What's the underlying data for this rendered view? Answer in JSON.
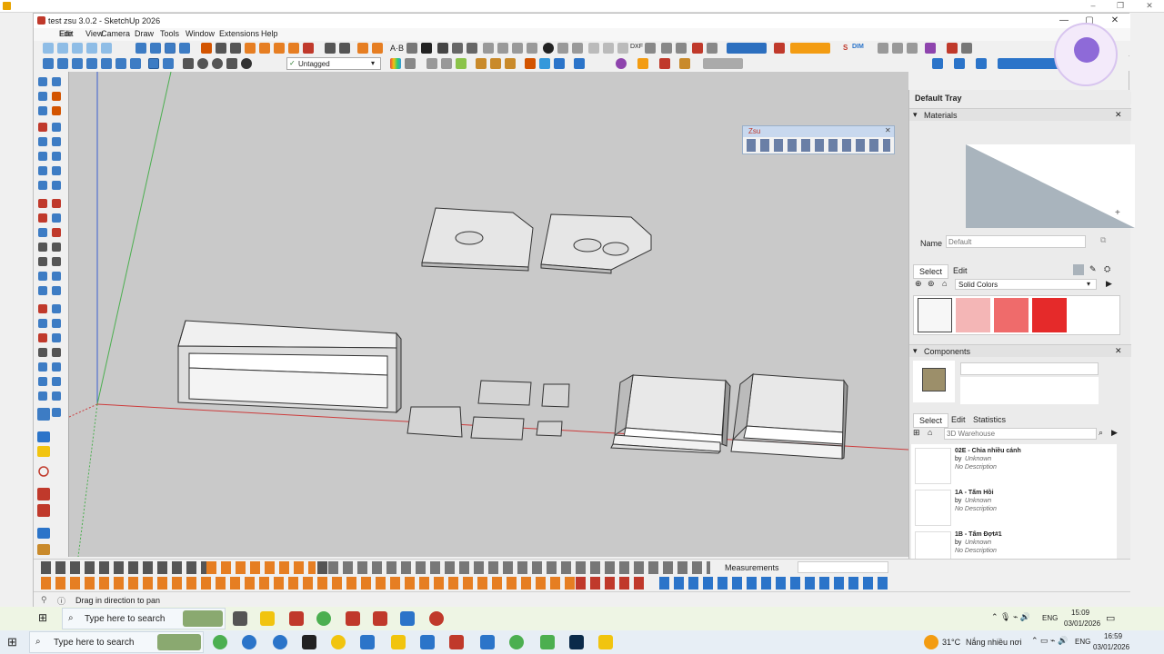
{
  "window": {
    "title": "test zsu 3.0.2 - SketchUp 2026"
  },
  "menu": [
    "File",
    "Edit",
    "View",
    "Camera",
    "Draw",
    "Tools",
    "Window",
    "Extensions",
    "Help"
  ],
  "toolbar": {
    "tag_select": "Untagged",
    "dxf_label": "DXF",
    "dim_label": "DIM",
    "s_label": "S"
  },
  "floating_toolbar": {
    "title": "Zsu"
  },
  "tray": {
    "title": "Default Tray",
    "materials": {
      "header": "Materials",
      "name_label": "Name",
      "name_placeholder": "Default",
      "tabs": [
        "Select",
        "Edit"
      ],
      "collection": "Solid Colors",
      "swatches": [
        "#f7f7f7",
        "#f4b6b6",
        "#ef6b6b",
        "#e52a2a"
      ]
    },
    "components": {
      "header": "Components",
      "tabs": [
        "Select",
        "Edit",
        "Statistics"
      ],
      "search_placeholder": "3D Warehouse",
      "items": [
        {
          "name": "02E - Chia nhiều cánh",
          "by": "by",
          "author": "Unknown",
          "desc": "No Description"
        },
        {
          "name": "1A - Tấm Hồi",
          "by": "by",
          "author": "Unknown",
          "desc": "No Description"
        },
        {
          "name": "1B - Tấm Đợt#1",
          "by": "by",
          "author": "Unknown",
          "desc": "No Description"
        }
      ]
    }
  },
  "measurements_label": "Measurements",
  "status_text": "Drag in direction to pan",
  "taskbar_inner": {
    "search": "Type here to search",
    "time": "15:09",
    "date": "03/01/2026",
    "lang": "ENG"
  },
  "taskbar_outer": {
    "search": "Type here to search",
    "temp": "31°C",
    "weather": "Nắng nhiều nơi",
    "lang": "ENG",
    "time": "16:59",
    "date": "03/01/2026"
  },
  "colors": {
    "viewport_bg": "#c9c9c9",
    "red_axis": "#cc3b3b",
    "green_axis": "#4caf50",
    "blue_axis": "#3a5fcf",
    "accent": "#2b74c9"
  }
}
